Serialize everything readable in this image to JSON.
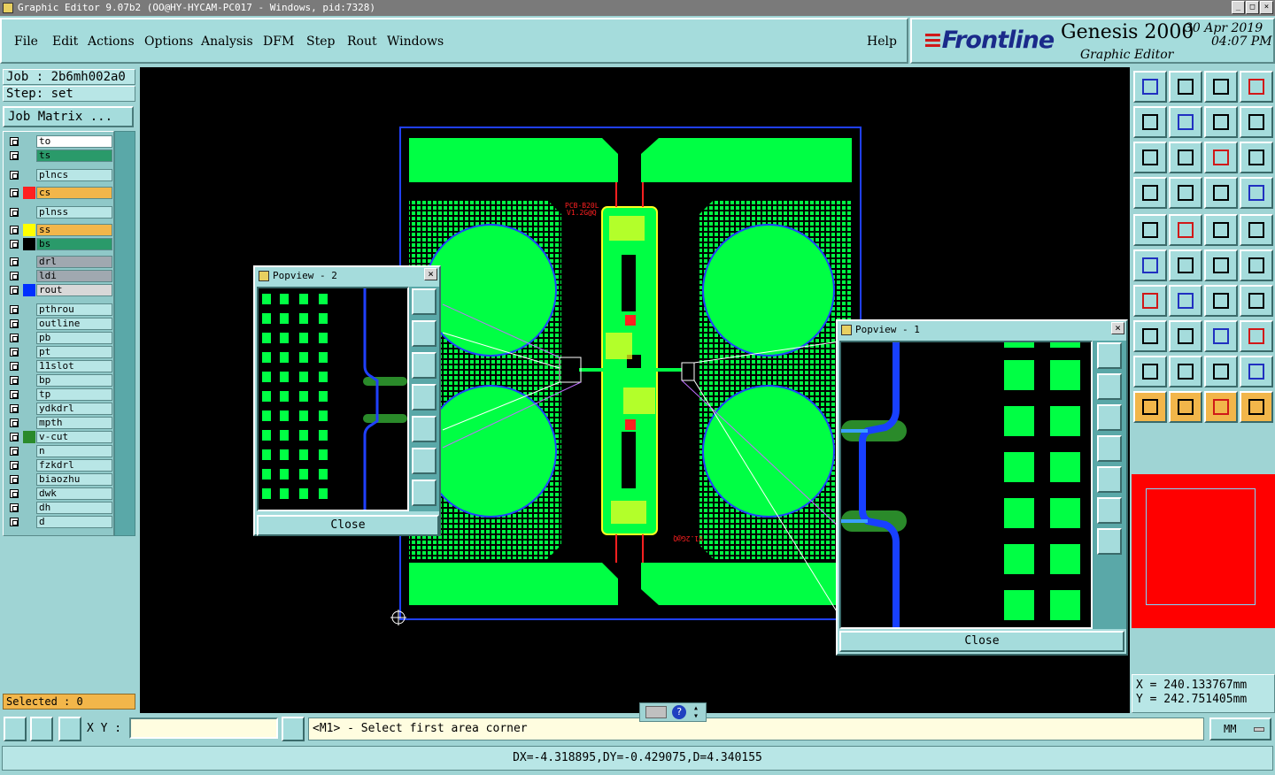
{
  "window": {
    "title": "Graphic Editor 9.07b2 (OO@HY-HYCAM-PC017 - Windows, pid:7328)"
  },
  "menus": [
    "File",
    "Edit",
    "Actions",
    "Options",
    "Analysis",
    "DFM",
    "Step",
    "Rout",
    "Windows"
  ],
  "help_label": "Help",
  "logo": {
    "brand": "Frontline",
    "product": "Genesis 2000",
    "subtitle": "Graphic Editor",
    "date": "30 Apr 2019",
    "time": "04:07 PM"
  },
  "job": {
    "job_label": "Job : 2b6mh002a0",
    "step_label": "Step: set",
    "matrix_button": "Job Matrix ..."
  },
  "layers": [
    {
      "name": "to",
      "color": "#ffffff",
      "swatch": ""
    },
    {
      "name": "ts",
      "color": "#2a9a6a",
      "swatch": ""
    },
    {
      "name": "plncs",
      "color": "#b8e6e6",
      "swatch": ""
    },
    {
      "name": "cs",
      "color": "#f2b64a",
      "swatch": "#ff2020",
      "active": true
    },
    {
      "name": "plnss",
      "color": "#b8e6e6",
      "swatch": ""
    },
    {
      "name": "ss",
      "color": "#f2b64a",
      "swatch": "#ffff00"
    },
    {
      "name": "bs",
      "color": "#2a9a6a",
      "swatch": "#000000"
    },
    {
      "name": "drl",
      "color": "#a0a8b0",
      "swatch": ""
    },
    {
      "name": "ldi",
      "color": "#a0a8b0",
      "swatch": ""
    },
    {
      "name": "rout",
      "color": "#d8d8d8",
      "swatch": "#0030ff"
    },
    {
      "name": "pthrou",
      "color": "#b8e6e6",
      "swatch": ""
    },
    {
      "name": "outline",
      "color": "#b8e6e6",
      "swatch": ""
    },
    {
      "name": "pb",
      "color": "#b8e6e6",
      "swatch": ""
    },
    {
      "name": "pt",
      "color": "#b8e6e6",
      "swatch": ""
    },
    {
      "name": "11slot",
      "color": "#b8e6e6",
      "swatch": ""
    },
    {
      "name": "bp",
      "color": "#b8e6e6",
      "swatch": ""
    },
    {
      "name": "tp",
      "color": "#b8e6e6",
      "swatch": ""
    },
    {
      "name": "ydkdrl",
      "color": "#b8e6e6",
      "swatch": ""
    },
    {
      "name": "mpth",
      "color": "#b8e6e6",
      "swatch": ""
    },
    {
      "name": "v-cut",
      "color": "#b8e6e6",
      "swatch": "#2a8a2a"
    },
    {
      "name": "n",
      "color": "#b8e6e6",
      "swatch": ""
    },
    {
      "name": "fzkdrl",
      "color": "#b8e6e6",
      "swatch": ""
    },
    {
      "name": "biaozhu",
      "color": "#b8e6e6",
      "swatch": ""
    },
    {
      "name": "dwk",
      "color": "#b8e6e6",
      "swatch": ""
    },
    {
      "name": "dh",
      "color": "#b8e6e6",
      "swatch": ""
    },
    {
      "name": "d",
      "color": "#b8e6e6",
      "swatch": ""
    }
  ],
  "selected_label": "Selected : 0",
  "popview2": {
    "title": "Popview - 2",
    "close_label": "Close"
  },
  "popview1": {
    "title": "Popview - 1",
    "close_label": "Close"
  },
  "canvas_labels": {
    "top_text": "PCB-B20L",
    "top_text2": "V1.2G@Q",
    "bottom_text": "V1.2G@Q"
  },
  "coords": {
    "x": "X = 240.133767mm",
    "y": "Y = 242.751405mm"
  },
  "bottom": {
    "xy_label": "X Y :",
    "prompt": "<M1> - Select first area corner",
    "units": "MM",
    "status": "DX=-4.318895,DY=-0.429075,D=4.340155"
  },
  "colors": {
    "copper": "#00ff44",
    "board_outline": "#2040ff",
    "silkscreen": "#ffff20",
    "drill": "#ff2020",
    "accent_panel": "#9fd4d4"
  }
}
